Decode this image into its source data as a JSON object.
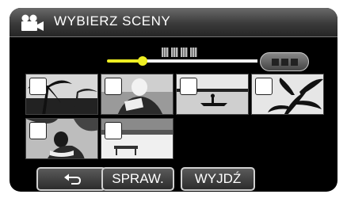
{
  "header": {
    "title": "WYBIERZ SCENY",
    "icon": "video-camera-icon"
  },
  "buttons": {
    "back_icon": "return-arrow-icon",
    "check_label": "SPRAW.",
    "exit_label": "WYJDŹ"
  },
  "thumbnails": [
    {
      "scene": "palm-tree-silhouette",
      "selected": false
    },
    {
      "scene": "person-reading",
      "selected": false
    },
    {
      "scene": "canoe-on-water",
      "selected": false
    },
    {
      "scene": "leaf-silhouette",
      "selected": false
    },
    {
      "scene": "family-on-beach",
      "selected": false
    },
    {
      "scene": "bench-in-snow",
      "selected": false
    }
  ],
  "colors": {
    "accent": "#eeee22",
    "panel": "#000000",
    "button_border": "#d0d0d0"
  }
}
